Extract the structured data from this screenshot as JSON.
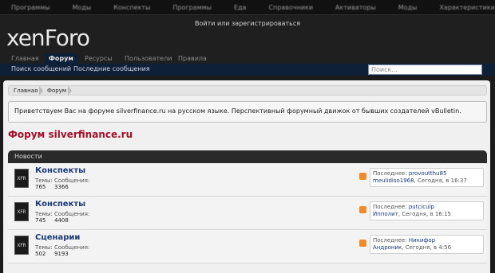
{
  "topbar": {
    "links": [
      "Программы",
      "Моды",
      "Конспекты",
      "Программы",
      "Еда",
      "Справочники",
      "Активаторы",
      "Моды",
      "Характеристики"
    ]
  },
  "header": {
    "logo_main": "xen",
    "logo_tail": "Foro",
    "login_text": "Войти или зарегистрироваться"
  },
  "tabs": [
    {
      "label": "Главная"
    },
    {
      "label": "Форум"
    },
    {
      "label": "Ресурсы"
    },
    {
      "label": "Пользователи"
    },
    {
      "label": "Правила"
    }
  ],
  "subnav": {
    "links": [
      "Поиск сообщений",
      "Последние сообщения"
    ],
    "search_placeholder": "Поиск..."
  },
  "breadcrumb": [
    "Главная",
    "Форум"
  ],
  "notice": "Приветствуем Вас на форуме silverfinance.ru на русском языке. Перспективный форумный движок от бывших создателей vBulletin.",
  "forum_title": "Форум silverfinance.ru",
  "category": {
    "title": "Новости",
    "stats_labels": {
      "threads": "Темы:",
      "posts": "Сообщения:"
    },
    "icon_text": "XFR",
    "nodes": [
      {
        "title": "Конспекты",
        "threads": "765",
        "posts": "3366",
        "last_label": "Последнее:",
        "last_title": "provoutthu85",
        "last_user": "meulidiso1968",
        "last_time": ", Сегодня, в 16:37"
      },
      {
        "title": "Конспекты",
        "threads": "745",
        "posts": "4408",
        "last_label": "Последнее:",
        "last_title": "putciculp",
        "last_user": "Ипполит",
        "last_time": ", Сегодня, в 16:15"
      },
      {
        "title": "Сценарии",
        "threads": "502",
        "posts": "9193",
        "last_label": "Последнее:",
        "last_title": "Никифор",
        "last_user": "Андроник",
        "last_time": ", Сегодня, в 4:56"
      }
    ]
  }
}
